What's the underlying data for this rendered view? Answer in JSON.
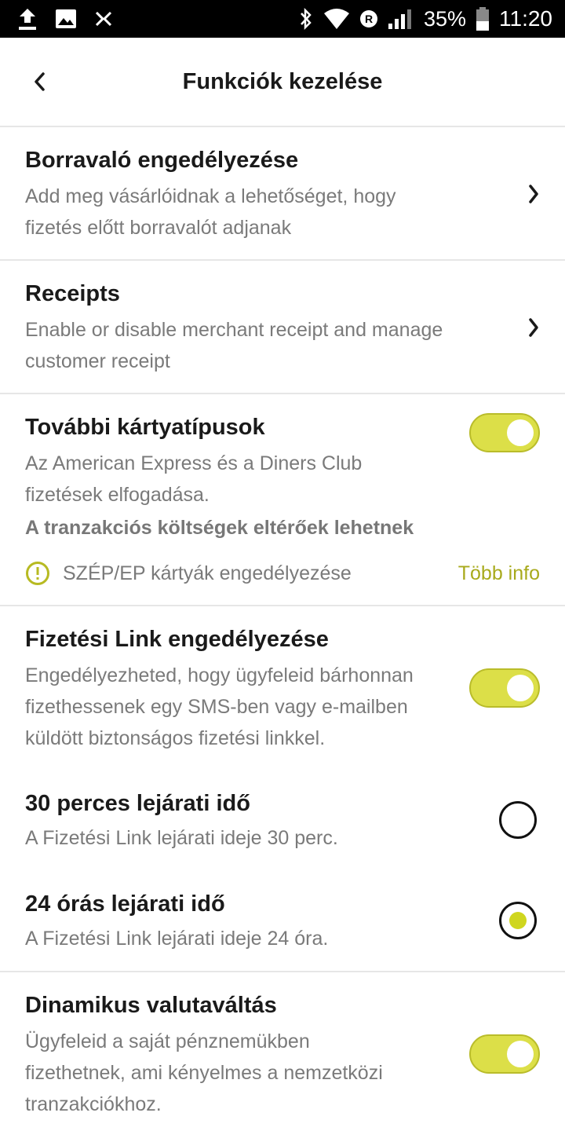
{
  "status_bar": {
    "battery": "35%",
    "time": "11:20",
    "icons": [
      "upload-icon",
      "image-icon",
      "app-icon",
      "bluetooth-icon",
      "wifi-icon",
      "roaming-icon",
      "signal-icon",
      "battery-icon"
    ]
  },
  "header": {
    "title": "Funkciók kezelése"
  },
  "tips": {
    "title": "Borravaló engedélyezése",
    "desc_line1": "Add meg vásárlóidnak a lehetőséget, hogy",
    "desc_line2": "fizetés előtt borravalót adjanak"
  },
  "receipts": {
    "title": "Receipts",
    "desc_line1": "Enable or disable merchant receipt and manage",
    "desc_line2": "customer receipt"
  },
  "cards": {
    "title": "További kártyatípusok",
    "desc_line1": "Az American Express és a Diners Club",
    "desc_line2": "fizetések elfogadása.",
    "note": "A tranzakciós költségek eltérőek lehetnek",
    "toggle_on": true,
    "info_text": "SZÉP/EP kártyák engedélyezése",
    "more_info": "Több info"
  },
  "payment_link": {
    "title": "Fizetési Link engedélyezése",
    "desc_line1": "Engedélyezheted, hogy ügyfeleid bárhonnan",
    "desc_line2": "fizethessenek egy SMS-ben vagy e-mailben",
    "desc_line3": "küldött biztonságos fizetési linkkel.",
    "toggle_on": true
  },
  "expiry_30": {
    "title": "30 perces lejárati idő",
    "desc": "A Fizetési Link lejárati ideje 30 perc.",
    "selected": false
  },
  "expiry_24": {
    "title": "24 órás lejárati idő",
    "desc": "A Fizetési Link lejárati ideje 24 óra.",
    "selected": true
  },
  "dcc": {
    "title": "Dinamikus valutaváltás",
    "desc_line1": "Ügyfeleid a saját pénznemükben",
    "desc_line2": "fizethetnek, ami kényelmes a nemzetközi",
    "desc_line3": "tranzakciókhoz.",
    "toggle_on": true
  },
  "colors": {
    "accent": "#dcdf48",
    "link": "#a8aa1c",
    "secondary_text": "#7a7a7a"
  }
}
